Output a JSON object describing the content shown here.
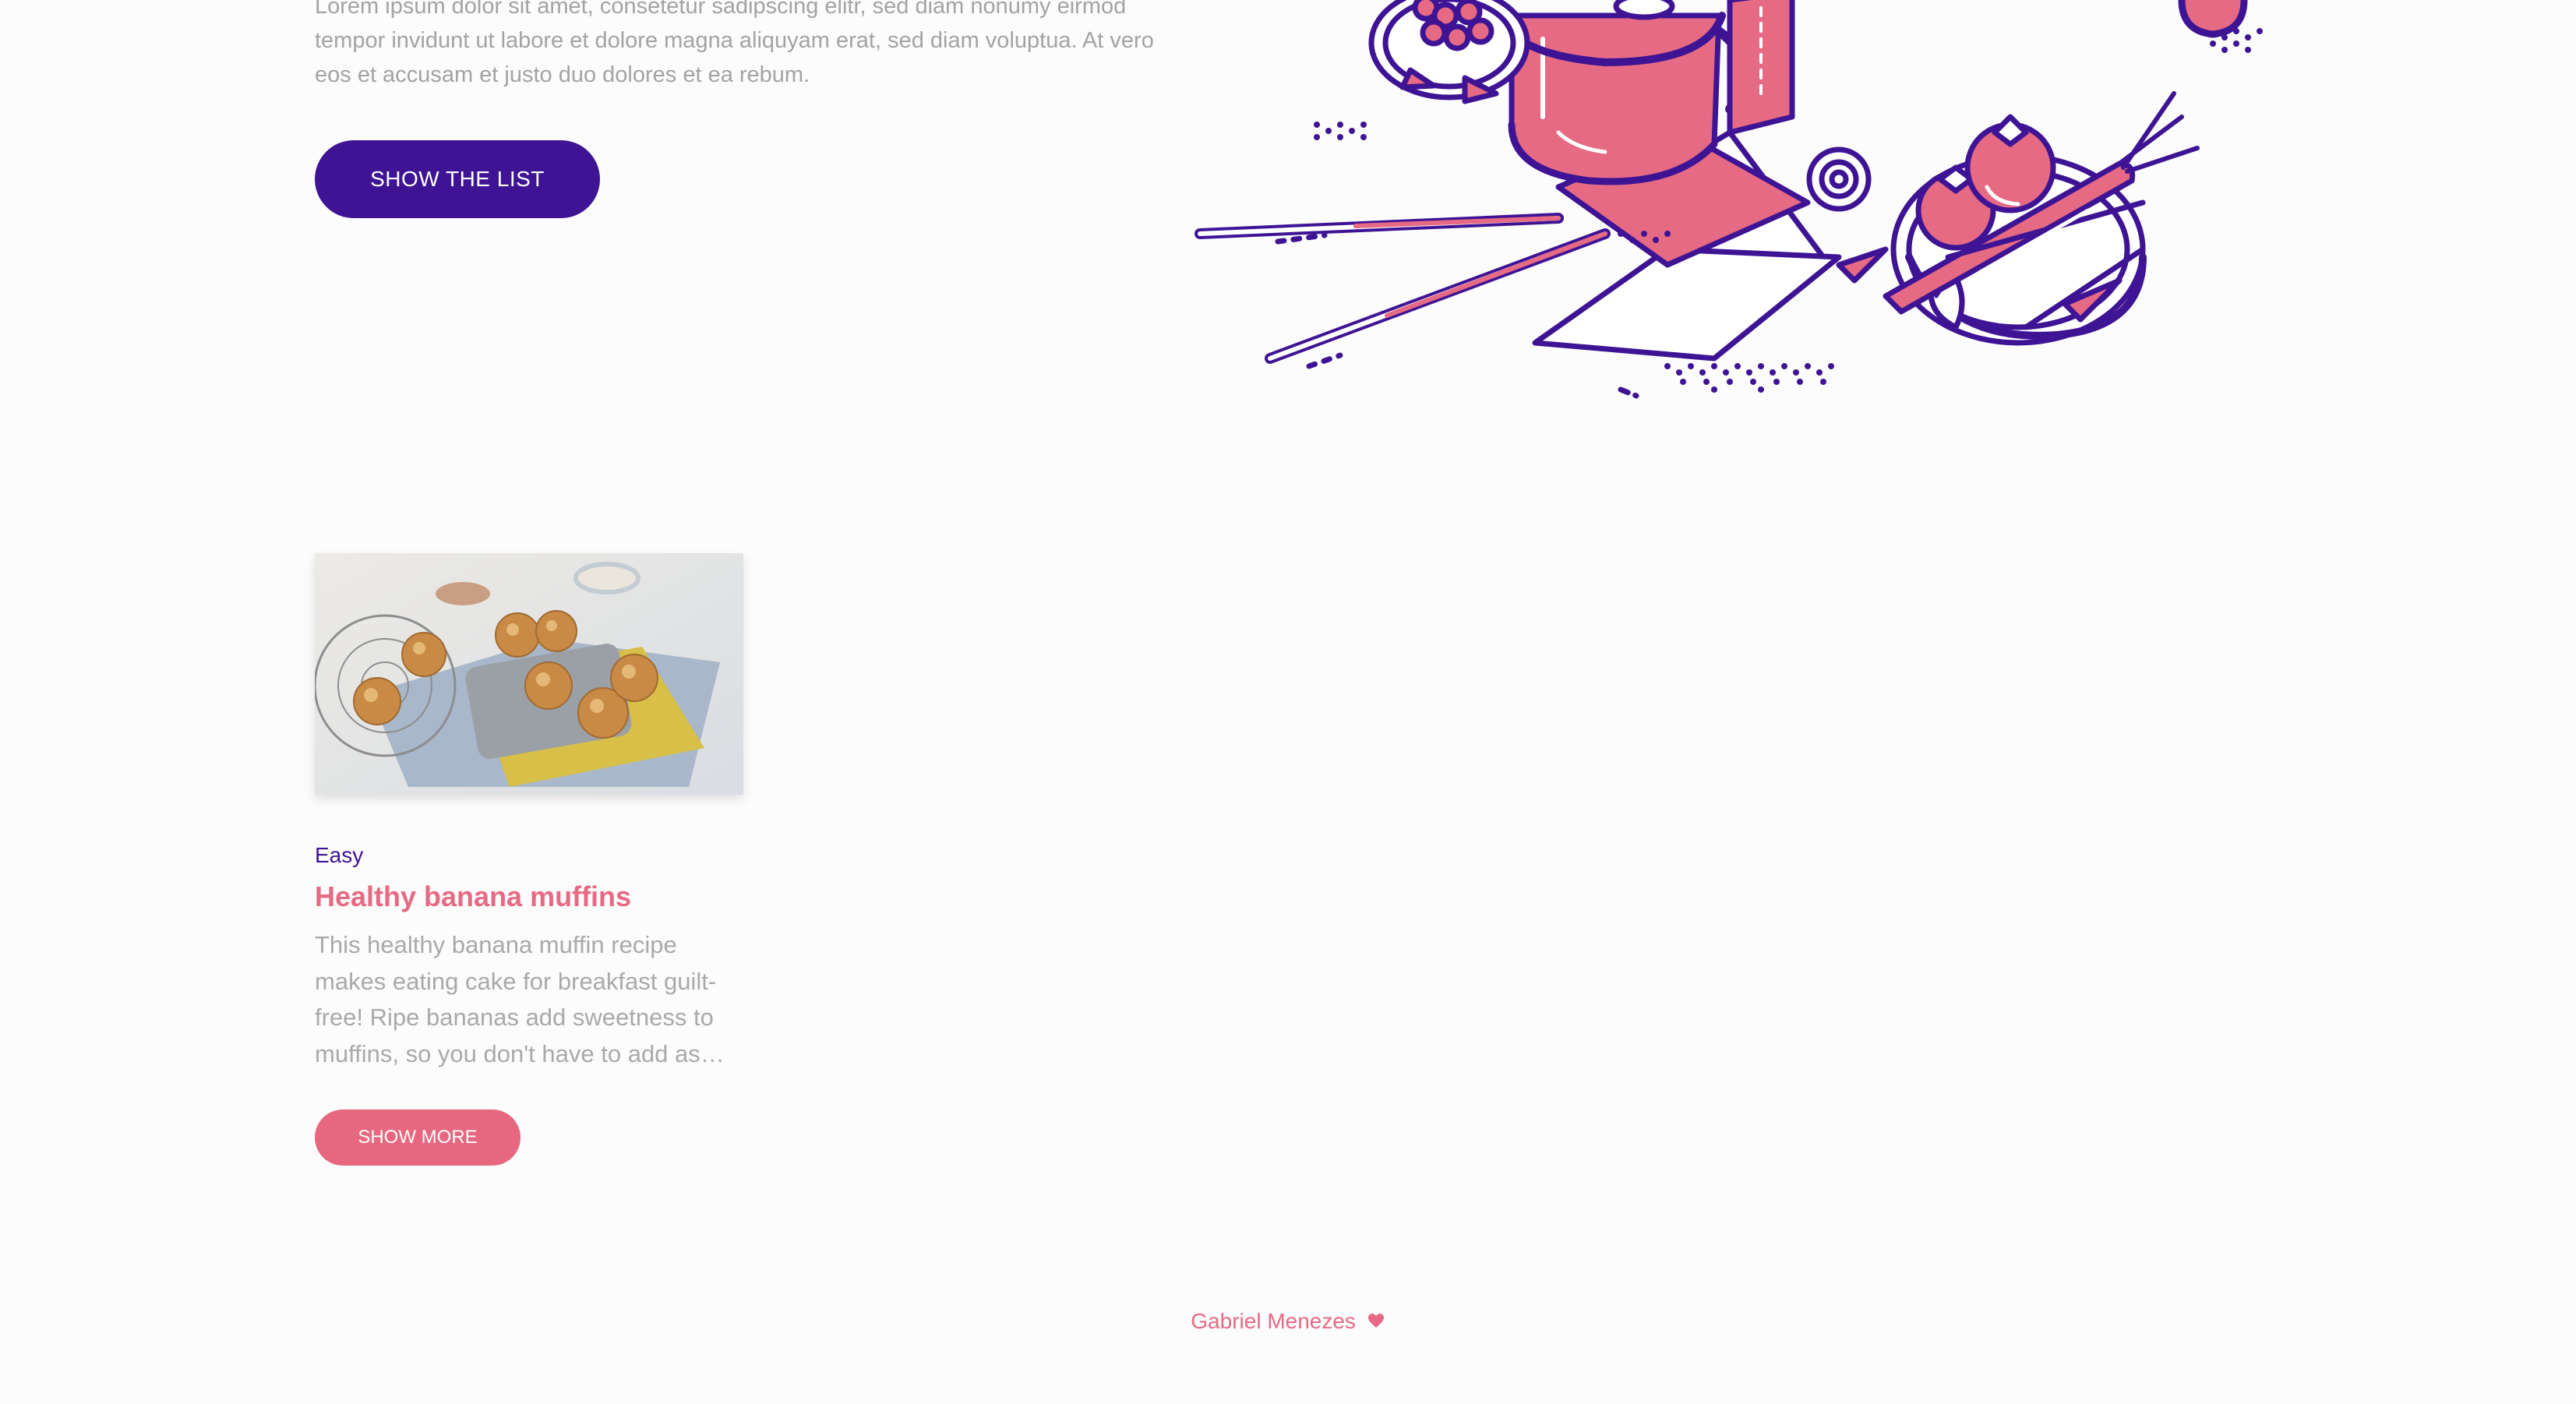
{
  "hero": {
    "text": "Lorem ipsum dolor sit amet, consetetur sadipscing elitr, sed diam nonumy eirmod tempor invidunt ut labore et dolore magna aliquyam erat, sed diam voluptua. At vero eos et accusam et justo duo dolores et ea rebum.",
    "button_label": "SHOW THE LIST"
  },
  "recipe_card": {
    "difficulty": "Easy",
    "title": "Healthy banana muffins",
    "description": "This healthy banana muffin recipe makes eating cake for breakfast guilt-free! Ripe bananas add sweetness to muffins, so you don't have to add as much sugar.",
    "button_label": "SHOW MORE"
  },
  "footer": {
    "author": "Gabriel Menezes",
    "icon": "heart-icon"
  },
  "colors": {
    "primary": "#3e1495",
    "accent": "#e66a83",
    "text_muted": "#a3a3a3",
    "background": "#fdfcfc"
  }
}
